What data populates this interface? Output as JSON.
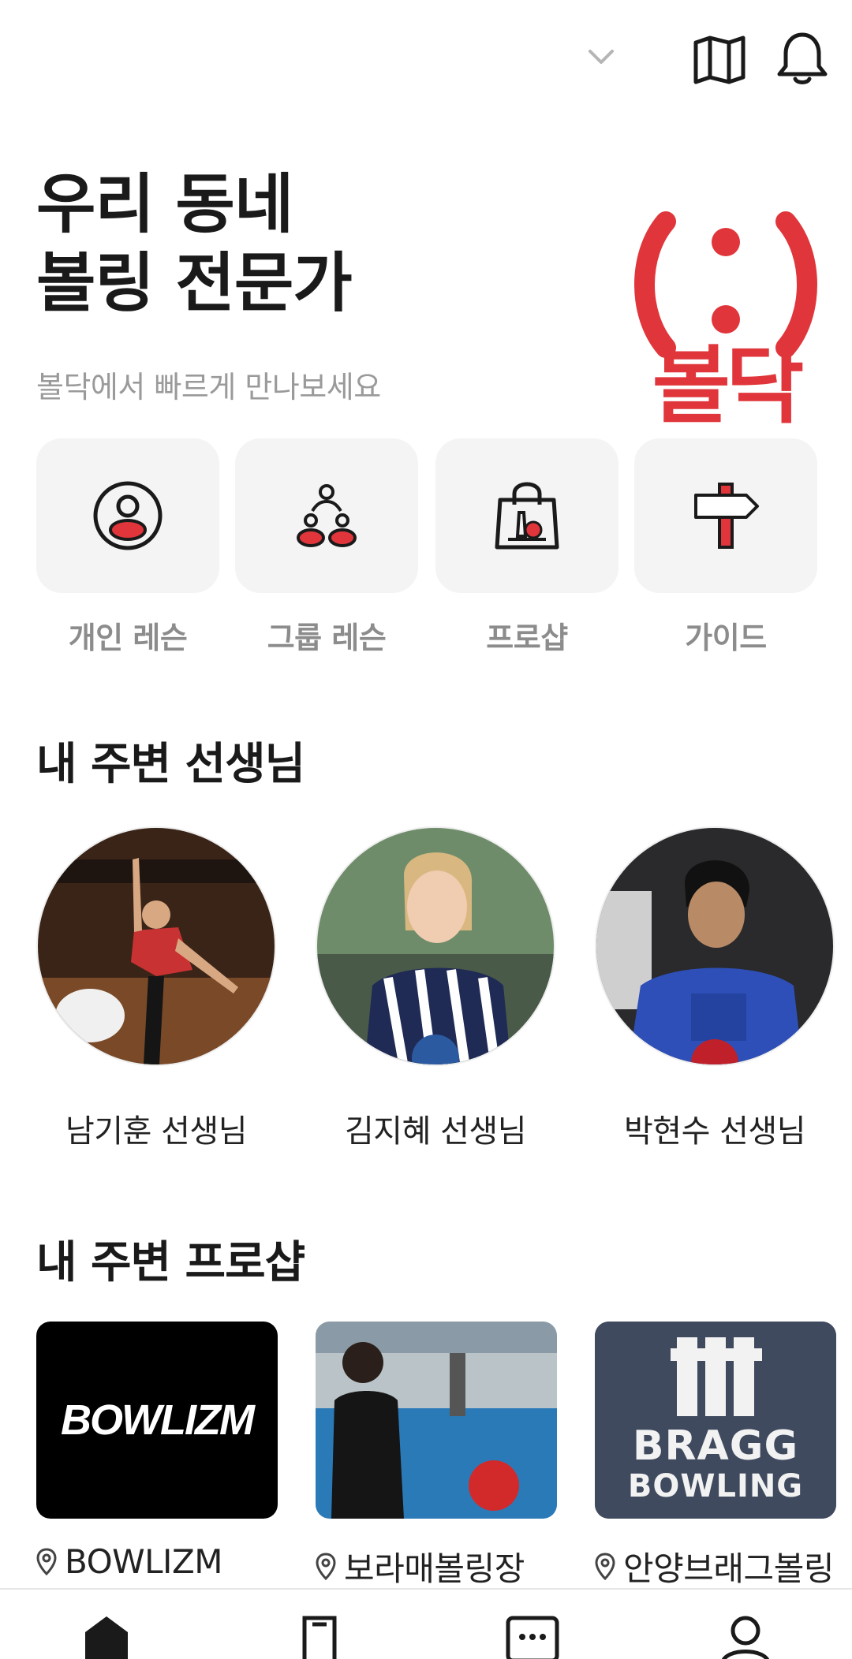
{
  "header": {
    "icons": [
      "chevron-down-icon",
      "map-icon",
      "bell-icon"
    ]
  },
  "hero": {
    "title_line1": "우리 동네",
    "title_line2": "볼링 전문가",
    "subtitle": "볼닥에서 빠르게 만나보세요",
    "logo_text": "볼닥",
    "brand_color": "#e0363b"
  },
  "quick_menu": [
    {
      "label": "개인 레슨",
      "icon": "person-icon"
    },
    {
      "label": "그룹 레슨",
      "icon": "group-icon"
    },
    {
      "label": "프로샵",
      "icon": "shopping-bag-icon"
    },
    {
      "label": "가이드",
      "icon": "signpost-icon"
    }
  ],
  "teachers_section": {
    "title": "내 주변 선생님",
    "items": [
      {
        "name": "남기훈 선생님"
      },
      {
        "name": "김지혜 선생님"
      },
      {
        "name": "박현수 선생님"
      }
    ]
  },
  "shops_section": {
    "title": "내 주변 프로샵",
    "items": [
      {
        "name": "BOWLIZM",
        "logo_text": "BOWLIZM"
      },
      {
        "name": "보라매볼링장"
      },
      {
        "name": "안양브래그볼링",
        "logo_text_1": "BRAGG",
        "logo_text_2": "BOWLING"
      }
    ]
  },
  "tabbar": {
    "icons": [
      "home-icon",
      "bookmark-icon",
      "chat-icon",
      "profile-icon"
    ]
  }
}
